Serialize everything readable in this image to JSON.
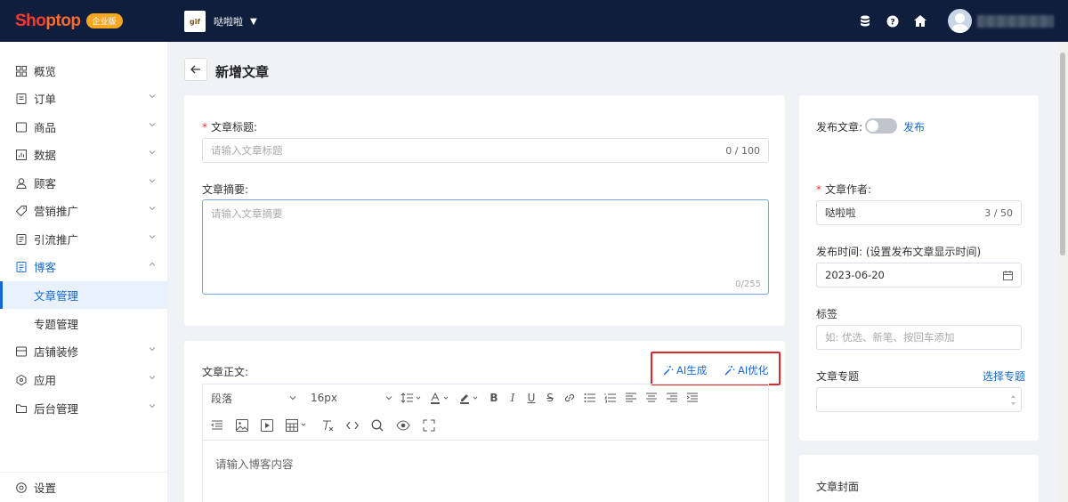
{
  "header": {
    "logo_text_a": "Sho",
    "logo_text_b": "ptop",
    "edition": "企业版",
    "store_name": "哒啦啦",
    "store_logo_text": "gif"
  },
  "sidebar": {
    "items": [
      {
        "label": "概览"
      },
      {
        "label": "订单"
      },
      {
        "label": "商品"
      },
      {
        "label": "数据"
      },
      {
        "label": "顾客"
      },
      {
        "label": "营销推广"
      },
      {
        "label": "引流推广"
      },
      {
        "label": "博客"
      },
      {
        "label": "文章管理"
      },
      {
        "label": "专题管理"
      },
      {
        "label": "店铺装修"
      },
      {
        "label": "应用"
      },
      {
        "label": "后台管理"
      }
    ],
    "settings": "设置"
  },
  "page": {
    "title": "新增文章"
  },
  "form": {
    "title_label": "文章标题:",
    "title_placeholder": "请输入文章标题",
    "title_count": "0 / 100",
    "summary_label": "文章摘要:",
    "summary_placeholder": "请输入文章摘要",
    "summary_count": "0/255",
    "body_label": "文章正文:",
    "ai_generate": "AI生成",
    "ai_optimize": "AI优化",
    "paragraph": "段落",
    "font_size": "16px",
    "body_placeholder": "请输入博客内容"
  },
  "side_panel": {
    "publish_label": "发布文章:",
    "publish_link": "发布",
    "author_label": "文章作者:",
    "author_value": "哒啦啦",
    "author_count": "3 / 50",
    "time_label": "发布时间: (设置发布文章显示时间)",
    "time_value": "2023-06-20",
    "tag_label": "标签",
    "tag_placeholder": "如: 优选、新笔、按回车添加",
    "topic_label": "文章专题",
    "topic_link": "选择专题",
    "cover_label": "文章封面"
  },
  "colors": {
    "topbar": "#0f1e3c",
    "accent": "#1769d1",
    "highlight": "#e0262b",
    "edition_badge": "#f5a623"
  }
}
